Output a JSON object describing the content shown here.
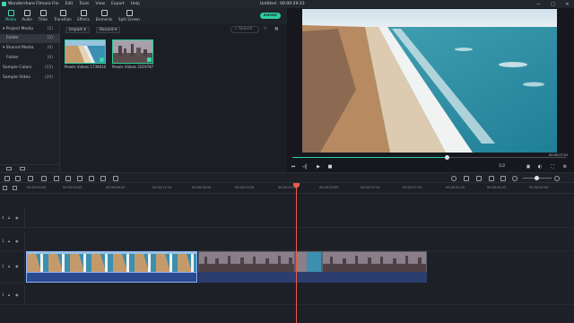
{
  "app": {
    "name": "Wondershare Filmora",
    "window_title": "Untitled : 00:00:29:23"
  },
  "menu": [
    "File",
    "Edit",
    "Tools",
    "View",
    "Export",
    "Help"
  ],
  "window_controls": [
    "—",
    "□",
    "✕"
  ],
  "toolbar": {
    "tabs": [
      {
        "label": "Media",
        "icon": "media-icon",
        "active": true
      },
      {
        "label": "Audio",
        "icon": "music-icon"
      },
      {
        "label": "Titles",
        "icon": "titles-icon"
      },
      {
        "label": "Transition",
        "icon": "transition-icon"
      },
      {
        "label": "Effects",
        "icon": "effects-icon"
      },
      {
        "label": "Elements",
        "icon": "elements-icon"
      },
      {
        "label": "Split Screen",
        "icon": "split-screen-icon"
      }
    ],
    "export_label": "EXPORT"
  },
  "library": {
    "items": [
      {
        "label": "Project Media",
        "count": "(2)"
      },
      {
        "label": "Folder",
        "count": "(2)",
        "active": true
      },
      {
        "label": "Shared Media",
        "count": "(0)"
      },
      {
        "label": "Folder",
        "count": "(0)"
      },
      {
        "label": "Sample Colors",
        "count": "(15)"
      },
      {
        "label": "Sample Video",
        "count": "(20)"
      }
    ]
  },
  "media": {
    "import_label": "Import",
    "record_label": "Record",
    "search_placeholder": "Search",
    "thumbnails": [
      {
        "label": "Pexels Videos 1739010"
      },
      {
        "label": "Pexels Videos 2019787"
      }
    ]
  },
  "preview": {
    "timecode": "00:00:27:01",
    "quality": "1/2"
  },
  "ruler": {
    "ticks": [
      "00:00:00:00",
      "00:00:04:05",
      "00:00:08:10",
      "00:00:12:15",
      "00:00:16:20",
      "00:00:20:25",
      "00:00:25:00",
      "00:00:29:05",
      "00:00:33:10",
      "00:00:37:15",
      "00:00:41:20",
      "00:00:45:25",
      "00:00:50:00"
    ]
  },
  "tracks": [
    "4",
    "3",
    "2",
    "1"
  ],
  "colors": {
    "accent": "#2ecf9f",
    "playhead": "#f05a4a",
    "audio": "#2c4a8f"
  }
}
